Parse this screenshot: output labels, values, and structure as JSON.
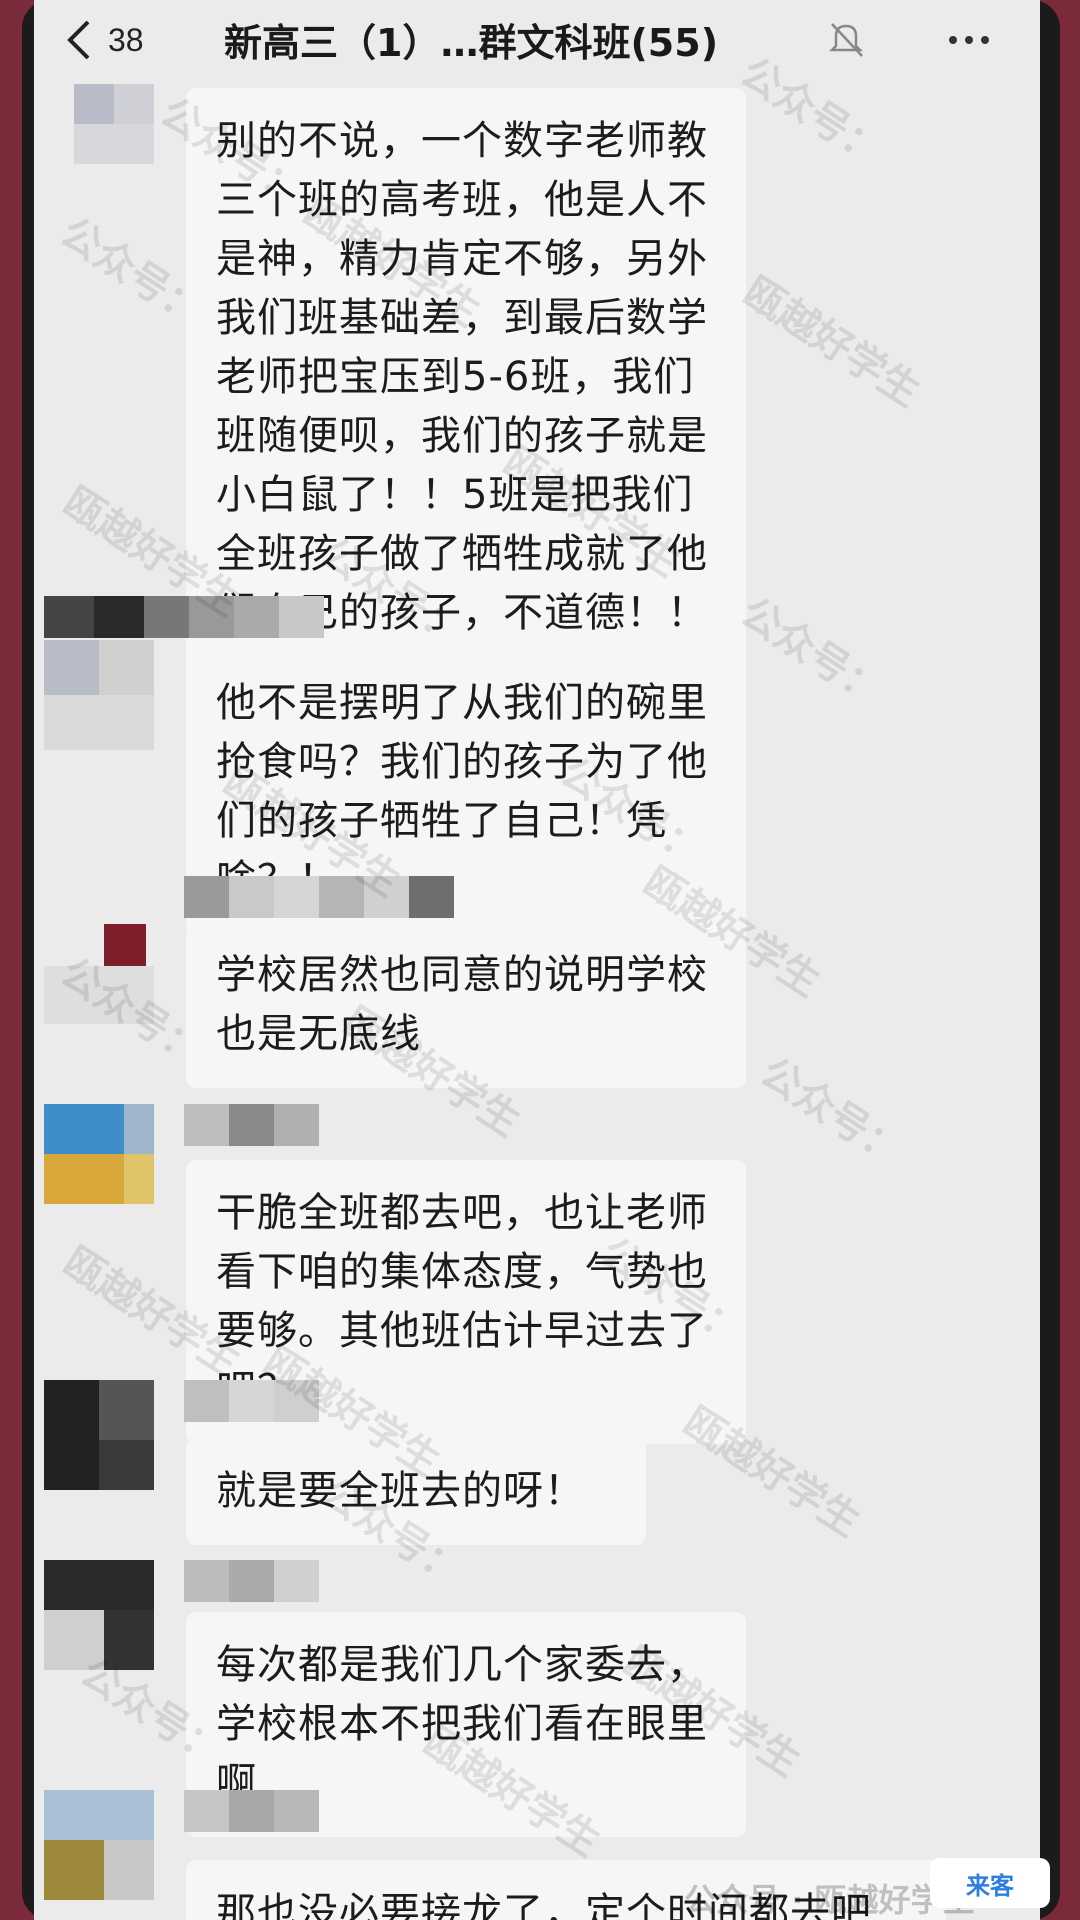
{
  "header": {
    "unread_count": "38",
    "chat_title": "新高三（1）…群文科班(55)"
  },
  "messages": [
    {
      "text": "别的不说，一个数字老师教三个班的高考班，他是人不是神，精力肯定不够，另外我们班基础差，到最后数学老师把宝压到5-6班，我们班随便呗，我们的孩子就是小白鼠了！！5班是把我们全班孩子做了牺牲成就了他们自己的孩子，不道德！！"
    },
    {
      "text": "他不是摆明了从我们的碗里抢食吗？我们的孩子为了他们的孩子牺牲了自己！凭啥？！"
    },
    {
      "text": "学校居然也同意的说明学校也是无底线"
    },
    {
      "text": "干脆全班都去吧，也让老师看下咱的集体态度，气势也要够。其他班估计早过去了吧？"
    },
    {
      "text": "就是要全班去的呀！"
    },
    {
      "text": "每次都是我们几个家委去，学校根本不把我们看在眼里啊"
    },
    {
      "text": "那也没必要接龙了，定个时间都去吧"
    }
  ],
  "watermark": {
    "text_a": "瓯越好学生",
    "text_b": "公众号：",
    "footer": "公众号 · 瓯越好学生"
  },
  "corner_badge": "来客"
}
